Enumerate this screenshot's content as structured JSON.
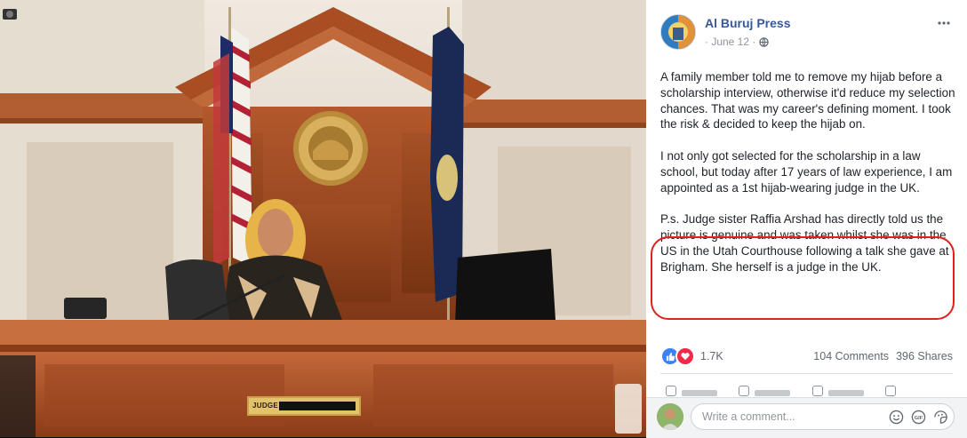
{
  "photo": {
    "nameplate": "JUDGE",
    "seal_text": "STATE OF UTAH · JUDICIARY"
  },
  "post": {
    "page_name": "Al Buruj Press",
    "date": "· June 12 ·",
    "privacy_icon": "globe-icon",
    "options_icon": "more-options-icon",
    "paragraphs": [
      "A family member told me to remove my hijab before a scholarship interview, otherwise it'd reduce my selection chances. That was my career's defining moment. I took the risk & decided to keep the hijab on.",
      "I not only got selected for the scholarship in a law school, but today after 17 years of law experience, I am appointed as a 1st hijab-wearing judge in the UK.",
      "P.s. Judge sister Raffia Arshad has directly told us the picture is genuine and was taken whilst she was in the US in the Utah Courthouse following a talk she gave at Brigham. She herself is a judge in the UK."
    ],
    "highlight_color": "#e0201c",
    "reactions": {
      "icons": [
        "like-icon",
        "love-icon"
      ],
      "count": "1.7K",
      "comments": "104 Comments",
      "shares": "396 Shares"
    }
  },
  "comment": {
    "placeholder": "Write a comment...",
    "icons": [
      "emoji-icon",
      "gif-icon",
      "sticker-icon"
    ]
  },
  "colors": {
    "link": "#365899",
    "text": "#1d2129",
    "muted": "#90949c",
    "like": "#3b82f6",
    "love": "#f0284a"
  }
}
